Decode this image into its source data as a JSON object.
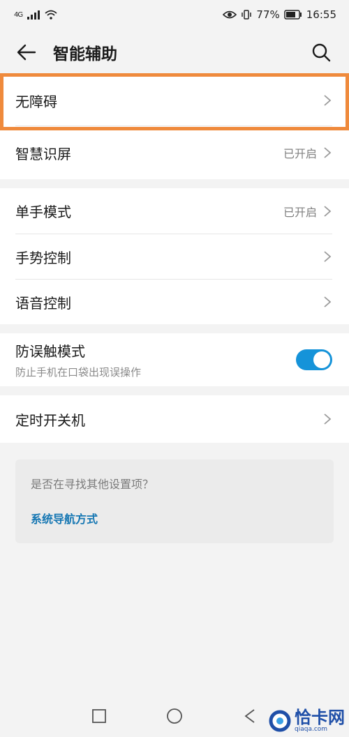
{
  "status": {
    "signal": "4G",
    "battery": "77%",
    "time": "16:55"
  },
  "appbar": {
    "title": "智能辅助",
    "back_icon": "arrow-left-icon",
    "search_icon": "search-icon"
  },
  "groups": {
    "g1": [
      {
        "label": "无障碍",
        "value": ""
      },
      {
        "label": "智慧识屏",
        "value": "已开启"
      }
    ],
    "g2": [
      {
        "label": "单手模式",
        "value": "已开启"
      },
      {
        "label": "手势控制",
        "value": ""
      },
      {
        "label": "语音控制",
        "value": ""
      }
    ],
    "g3": {
      "label": "防误触模式",
      "sub": "防止手机在口袋出现误操作",
      "toggle_on": true
    },
    "g4": [
      {
        "label": "定时开关机",
        "value": ""
      }
    ]
  },
  "suggest": {
    "question": "是否在寻找其他设置项？",
    "link": "系统导航方式"
  },
  "colors": {
    "accent": "#1593d9",
    "highlight": "#ef8a3c",
    "link": "#1677b3"
  },
  "watermark": {
    "text": "恰卡网",
    "sub": "qiaqa.com"
  }
}
